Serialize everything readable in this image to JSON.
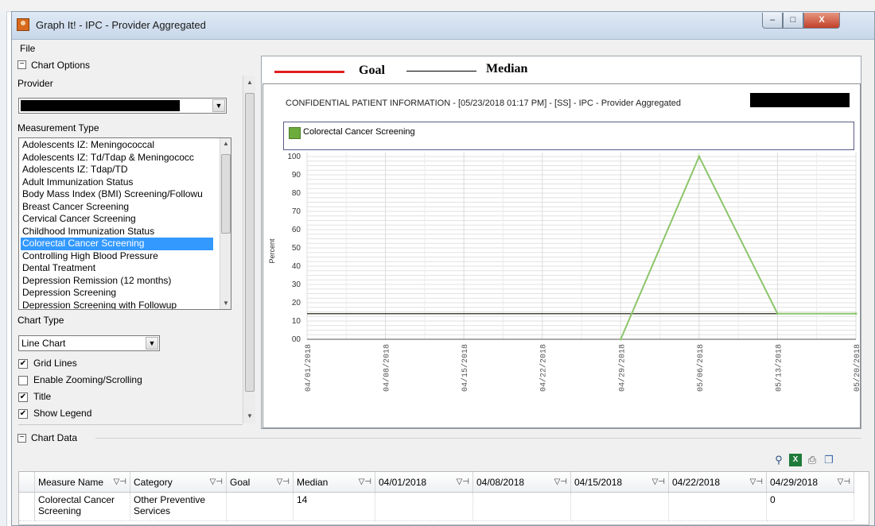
{
  "window": {
    "title": "Graph It! - IPC - Provider Aggregated",
    "controls": {
      "minimize": "–",
      "maximize": "□",
      "close": "X"
    }
  },
  "menu": {
    "file": "File"
  },
  "chart_options": {
    "section_label": "Chart Options",
    "provider_label": "Provider",
    "measurement_type_label": "Measurement Type",
    "measurement_types": [
      "Adolescents IZ: Meningococcal",
      "Adolescents IZ: Td/Tdap & Meningococc",
      "Adolescents IZ: Tdap/TD",
      "Adult Immunization Status",
      "Body Mass Index (BMI) Screening/Followu",
      "Breast Cancer Screening",
      "Cervical Cancer Screening",
      "Childhood Immunization Status",
      "Colorectal Cancer Screening",
      "Controlling High Blood Pressure",
      "Dental Treatment",
      "Depression Remission (12 months)",
      "Depression Screening",
      "Depression Screening with Followup"
    ],
    "selected_measurement_index": 8,
    "chart_type_label": "Chart Type",
    "chart_type_value": "Line Chart",
    "checkboxes": [
      {
        "label": "Grid Lines",
        "checked": true
      },
      {
        "label": "Enable Zooming/Scrolling",
        "checked": false
      },
      {
        "label": "Title",
        "checked": true
      },
      {
        "label": "Show Legend",
        "checked": true
      }
    ]
  },
  "legend": {
    "goal": "Goal",
    "median": "Median",
    "goal_color": "#e02020",
    "median_color": "#000000"
  },
  "chart_data": {
    "type": "line",
    "title": "CONFIDENTIAL PATIENT INFORMATION - [05/23/2018 01:17 PM] - [SS] - IPC - Provider Aggregated",
    "legend_entries": [
      "Colorectal Cancer Screening"
    ],
    "ylabel": "Percent",
    "ylim": [
      0,
      100
    ],
    "yticks": [
      "00",
      "10",
      "20",
      "30",
      "40",
      "50",
      "60",
      "70",
      "80",
      "90",
      "100"
    ],
    "categories": [
      "04/01/2018",
      "04/08/2018",
      "04/15/2018",
      "04/22/2018",
      "04/29/2018",
      "05/06/2018",
      "05/13/2018",
      "05/20/2018"
    ],
    "series": [
      {
        "name": "Colorectal Cancer Screening",
        "color": "#8cc56b",
        "values": [
          null,
          null,
          null,
          null,
          0,
          100,
          14,
          14
        ]
      }
    ],
    "median": 14,
    "grid": true,
    "median_color": "#4a4a3a"
  },
  "chart_data_section": {
    "label": "Chart Data",
    "columns": [
      "Measure Name",
      "Category",
      "Goal",
      "Median",
      "04/01/2018",
      "04/08/2018",
      "04/15/2018",
      "04/22/2018",
      "04/29/2018"
    ],
    "rows": [
      [
        "Colorectal Cancer Screening",
        "Other Preventive Services",
        "",
        "14",
        "",
        "",
        "",
        "",
        "0"
      ]
    ],
    "toolbar": [
      "binoculars-icon",
      "excel-icon",
      "print-icon",
      "copy-icon"
    ]
  }
}
